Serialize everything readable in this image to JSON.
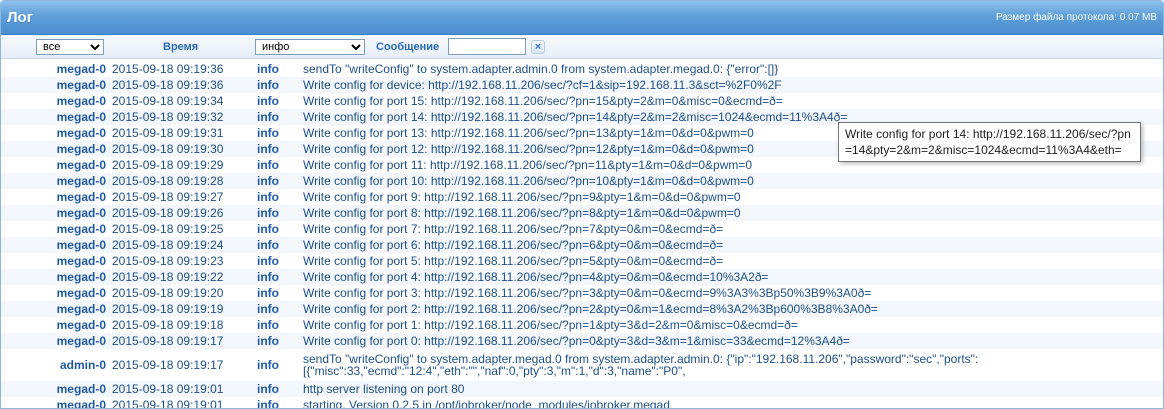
{
  "header": {
    "title": "Лог",
    "file_size": "Размер файла протокола: 0.07 MB"
  },
  "filters": {
    "source_selected": "все",
    "time_header": "Время",
    "level_selected": "инфо",
    "message_header": "Сообщение",
    "message_filter_value": "",
    "clear_symbol": "×"
  },
  "tooltip": "Write config for port 14: http://192.168.11.206/sec/?pn=14&pty=2&m=2&misc=1024&ecmd=11%3A4&eth=",
  "rows": [
    {
      "src": "megad-0",
      "time": "2015-09-18 09:19:36",
      "lvl": "info",
      "msg": "sendTo \"writeConfig\" to system.adapter.admin.0 from system.adapter.megad.0: {\"error\":[]}"
    },
    {
      "src": "megad-0",
      "time": "2015-09-18 09:19:36",
      "lvl": "info",
      "msg": "Write config for device: http://192.168.11.206/sec/?cf=1&sip=192.168.11.3&sct=%2F0%2F"
    },
    {
      "src": "megad-0",
      "time": "2015-09-18 09:19:34",
      "lvl": "info",
      "msg": "Write config for port 15: http://192.168.11.206/sec/?pn=15&pty=2&m=0&misc=0&ecmd=ð="
    },
    {
      "src": "megad-0",
      "time": "2015-09-18 09:19:32",
      "lvl": "info",
      "msg": "Write config for port 14: http://192.168.11.206/sec/?pn=14&pty=2&m=2&misc=1024&ecmd=11%3A4ð="
    },
    {
      "src": "megad-0",
      "time": "2015-09-18 09:19:31",
      "lvl": "info",
      "msg": "Write config for port 13: http://192.168.11.206/sec/?pn=13&pty=1&m=0&d=0&pwm=0"
    },
    {
      "src": "megad-0",
      "time": "2015-09-18 09:19:30",
      "lvl": "info",
      "msg": "Write config for port 12: http://192.168.11.206/sec/?pn=12&pty=1&m=0&d=0&pwm=0"
    },
    {
      "src": "megad-0",
      "time": "2015-09-18 09:19:29",
      "lvl": "info",
      "msg": "Write config for port 11: http://192.168.11.206/sec/?pn=11&pty=1&m=0&d=0&pwm=0"
    },
    {
      "src": "megad-0",
      "time": "2015-09-18 09:19:28",
      "lvl": "info",
      "msg": "Write config for port 10: http://192.168.11.206/sec/?pn=10&pty=1&m=0&d=0&pwm=0"
    },
    {
      "src": "megad-0",
      "time": "2015-09-18 09:19:27",
      "lvl": "info",
      "msg": "Write config for port 9: http://192.168.11.206/sec/?pn=9&pty=1&m=0&d=0&pwm=0"
    },
    {
      "src": "megad-0",
      "time": "2015-09-18 09:19:26",
      "lvl": "info",
      "msg": "Write config for port 8: http://192.168.11.206/sec/?pn=8&pty=1&m=0&d=0&pwm=0"
    },
    {
      "src": "megad-0",
      "time": "2015-09-18 09:19:25",
      "lvl": "info",
      "msg": "Write config for port 7: http://192.168.11.206/sec/?pn=7&pty=0&m=0&ecmd=ð="
    },
    {
      "src": "megad-0",
      "time": "2015-09-18 09:19:24",
      "lvl": "info",
      "msg": "Write config for port 6: http://192.168.11.206/sec/?pn=6&pty=0&m=0&ecmd=ð="
    },
    {
      "src": "megad-0",
      "time": "2015-09-18 09:19:23",
      "lvl": "info",
      "msg": "Write config for port 5: http://192.168.11.206/sec/?pn=5&pty=0&m=0&ecmd=ð="
    },
    {
      "src": "megad-0",
      "time": "2015-09-18 09:19:22",
      "lvl": "info",
      "msg": "Write config for port 4: http://192.168.11.206/sec/?pn=4&pty=0&m=0&ecmd=10%3A2ð="
    },
    {
      "src": "megad-0",
      "time": "2015-09-18 09:19:20",
      "lvl": "info",
      "msg": "Write config for port 3: http://192.168.11.206/sec/?pn=3&pty=0&m=0&ecmd=9%3A3%3Bp50%3B9%3A0ð="
    },
    {
      "src": "megad-0",
      "time": "2015-09-18 09:19:19",
      "lvl": "info",
      "msg": "Write config for port 2: http://192.168.11.206/sec/?pn=2&pty=0&m=1&ecmd=8%3A2%3Bp600%3B8%3A0ð="
    },
    {
      "src": "megad-0",
      "time": "2015-09-18 09:19:18",
      "lvl": "info",
      "msg": "Write config for port 1: http://192.168.11.206/sec/?pn=1&pty=3&d=2&m=0&misc=0&ecmd=ð="
    },
    {
      "src": "megad-0",
      "time": "2015-09-18 09:19:17",
      "lvl": "info",
      "msg": "Write config for port 0: http://192.168.11.206/sec/?pn=0&pty=3&d=3&m=1&misc=33&ecmd=12%3A4ð="
    },
    {
      "src": "admin-0",
      "time": "2015-09-18 09:19:17",
      "lvl": "info",
      "msg": "sendTo \"writeConfig\" to system.adapter.megad.0 from system.adapter.admin.0: {\"ip\":\"192.168.11.206\",\"password\":\"sec\",\"ports\":[{\"misc\":33,\"ecmd\":\"12:4\",\"eth\":\"\",\"naf\":0,\"pty\":3,\"m\":1,\"d\":3,\"name\":\"P0\",",
      "tall": true
    },
    {
      "src": "megad-0",
      "time": "2015-09-18 09:19:01",
      "lvl": "info",
      "msg": "http server listening on port 80"
    },
    {
      "src": "megad-0",
      "time": "2015-09-18 09:19:01",
      "lvl": "info",
      "msg": "starting. Version 0.2.5 in /opt/iobroker/node_modules/iobroker.megad"
    }
  ]
}
